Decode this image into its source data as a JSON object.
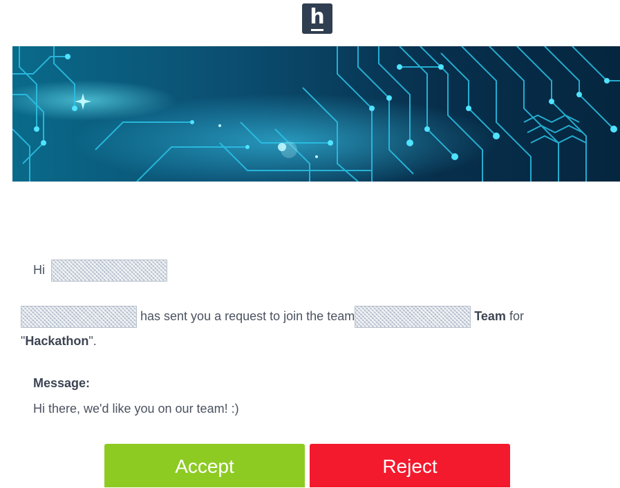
{
  "logo": {
    "letter": "h"
  },
  "email": {
    "greeting": "Hi",
    "request_text": "has sent you a request to join the team",
    "team_suffix": "Team",
    "for_word": "for",
    "quote_open": "\"",
    "event_name": "Hackathon",
    "quote_close": "\".",
    "message_label": "Message:",
    "message_text": "Hi there, we'd like you on our team! :)"
  },
  "buttons": {
    "accept_label": "Accept",
    "reject_label": "Reject"
  },
  "colors": {
    "logo_bg": "#2f3e50",
    "accept": "#8dcb23",
    "reject": "#f41a2d",
    "banner_dark": "#08324a",
    "circuit": "#38d6f2"
  }
}
